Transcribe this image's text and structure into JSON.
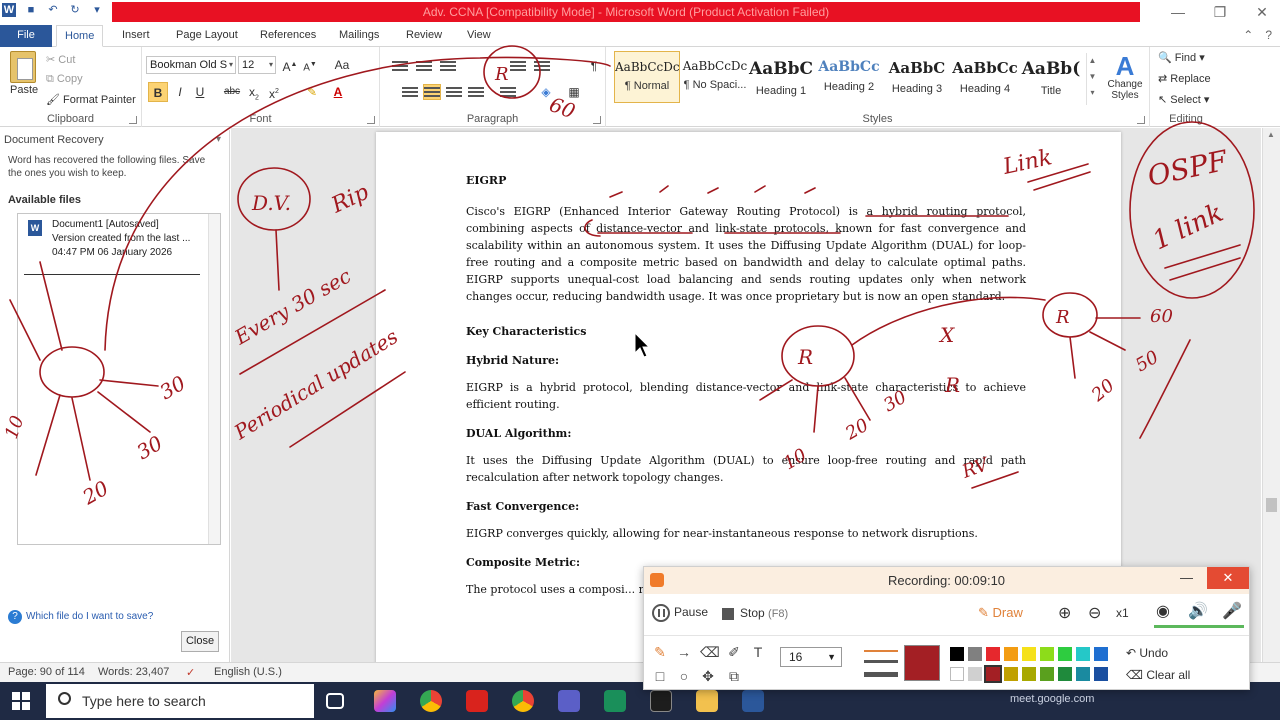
{
  "window": {
    "title": "Adv. CCNA [Compatibility Mode] - Microsoft Word (Product Activation Failed)"
  },
  "tabs": [
    "File",
    "Home",
    "Insert",
    "Page Layout",
    "References",
    "Mailings",
    "Review",
    "View"
  ],
  "ribbon": {
    "clipboard": {
      "paste": "Paste",
      "cut": "Cut",
      "copy": "Copy",
      "format_painter": "Format Painter",
      "label": "Clipboard"
    },
    "font": {
      "name": "Bookman Old S",
      "size": "12",
      "label": "Font"
    },
    "paragraph": {
      "label": "Paragraph"
    },
    "styles": {
      "label": "Styles",
      "items": [
        {
          "sample": "AaBbCcDc",
          "name": "¶ Normal"
        },
        {
          "sample": "AaBbCcDc",
          "name": "¶ No Spaci..."
        },
        {
          "sample": "AaBbC",
          "name": "Heading 1"
        },
        {
          "sample": "AaBbCc",
          "name": "Heading 2"
        },
        {
          "sample": "AaBbC",
          "name": "Heading 3"
        },
        {
          "sample": "AaBbCc",
          "name": "Heading 4"
        },
        {
          "sample": "AaBb(",
          "name": "Title"
        }
      ],
      "change_styles": "Change Styles"
    },
    "editing": {
      "find": "Find",
      "replace": "Replace",
      "select": "Select",
      "label": "Editing"
    }
  },
  "recovery": {
    "header": "Document Recovery",
    "description": "Word has recovered the following files. Save the ones you wish to keep.",
    "available": "Available files",
    "file_name": "Document1  [Autosaved]",
    "file_version": "Version created from the last ...",
    "file_time": "04:47 PM 06 January 2026",
    "help_link": "Which file do I want to save?",
    "close": "Close"
  },
  "document": {
    "title": "EIGRP",
    "intro": "Cisco's EIGRP (Enhanced Interior Gateway Routing Protocol) is a hybrid routing protocol, combining aspects of distance-vector and link-state protocols, known for fast convergence and scalability within an autonomous system. It uses the Diffusing Update Algorithm (DUAL) for loop-free routing and a composite metric based on bandwidth and delay to calculate optimal paths. EIGRP supports unequal-cost load balancing and sends routing updates only when network changes occur, reducing bandwidth usage. It was once proprietary but is now an open standard.",
    "key_heading": "Key Characteristics",
    "sections": [
      {
        "heading": "Hybrid Nature:",
        "text": "EIGRP is a hybrid protocol, blending distance-vector and link-state characteristics to achieve efficient routing."
      },
      {
        "heading": "DUAL Algorithm:",
        "text": "It uses the Diffusing Update Algorithm (DUAL) to ensure loop-free routing and rapid path recalculation after network topology changes."
      },
      {
        "heading": "Fast Convergence:",
        "text": "EIGRP converges quickly, allowing for near-instantaneous response to network disruptions."
      },
      {
        "heading": "Composite Metric:",
        "text": "The protocol uses a composi... reliability and load as option..."
      }
    ]
  },
  "statusbar": {
    "page": "Page: 90 of 114",
    "words": "Words: 23,407",
    "language": "English (U.S.)"
  },
  "taskbar": {
    "search_placeholder": "Type here to search",
    "meet": "meet.google.com"
  },
  "recorder": {
    "status": "Recording:  00:09:10",
    "pause": "Pause",
    "stop": "Stop",
    "stop_key": "(F8)",
    "draw": "Draw",
    "zoom": "x1",
    "size": "16",
    "undo": "Undo",
    "clear_all": "Clear all",
    "palette": [
      "#000000",
      "#808080",
      "#e6282d",
      "#f39c12",
      "#f5e11a",
      "#8ddc1a",
      "#2ecc40",
      "#25c8c8",
      "#1f6fd1",
      "#ffffff",
      "#d0d0d0",
      "#a31f24",
      "#c0a000",
      "#a8a800",
      "#5aa01e",
      "#1f8a3c",
      "#1a8aa0",
      "#1a4fa0"
    ]
  },
  "ink": {
    "labels": [
      "D.V.",
      "Rip",
      "Every 30 sec",
      "Periodical updates",
      "30",
      "30",
      "20",
      "10",
      "Link",
      "OSPF",
      "1 link",
      "60",
      "50",
      "20",
      "10",
      "20",
      "30",
      "X",
      "R",
      "RV"
    ]
  }
}
